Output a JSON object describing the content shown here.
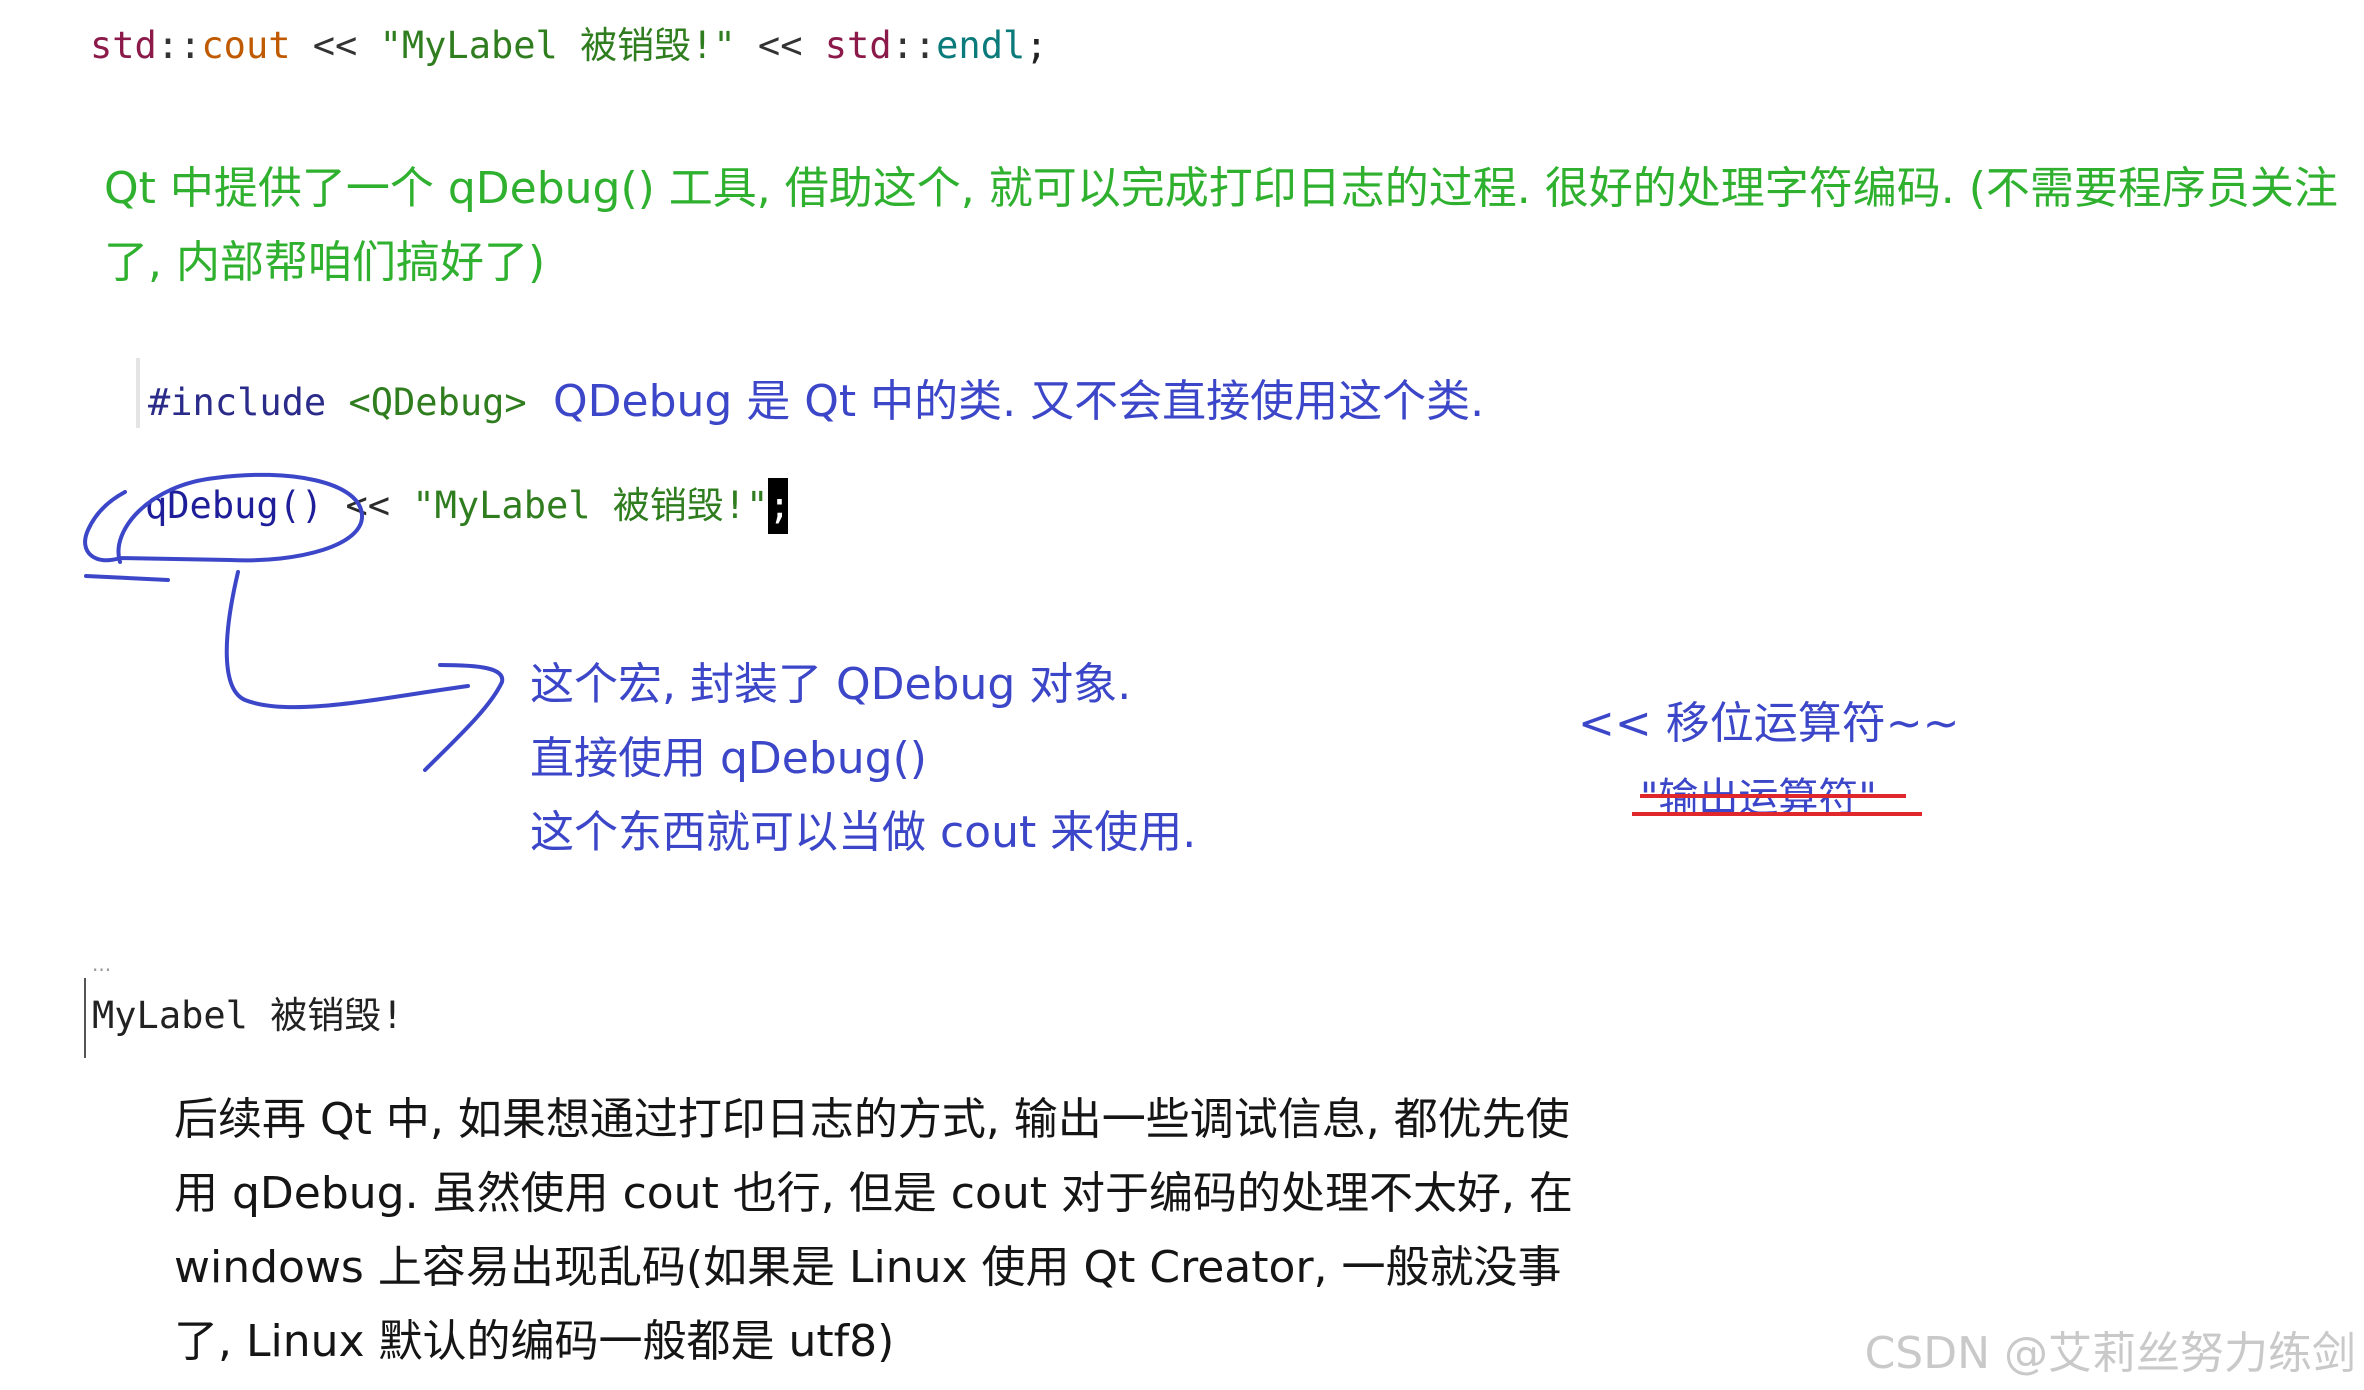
{
  "code_line_1": {
    "ns1": "std",
    "sep1": "::",
    "cout": "cout",
    "op1": " << ",
    "str": "\"MyLabel 被销毁!\"",
    "op2": " << ",
    "ns2": "std",
    "sep2": "::",
    "endl": "endl",
    "semi": ";"
  },
  "green_note": "Qt 中提供了一个 qDebug() 工具, 借助这个, 就可以完成打印日志的过程. 很好的处理字符编码. (不需要程序员关注了, 内部帮咱们搞好了)",
  "include_line": {
    "directive": "#include ",
    "header": "<QDebug>"
  },
  "include_note": "QDebug 是 Qt 中的类. 又不会直接使用这个类.",
  "qdebug_line": {
    "call": "qDebug()",
    "op": " << ",
    "str": "\"MyLabel 被销毁!\"",
    "semi": ";"
  },
  "macro_notes": [
    "这个宏, 封装了 QDebug 对象.",
    "直接使用 qDebug()",
    "这个东西就可以当做 cout 来使用."
  ],
  "shift_note": "<< 移位运算符~~",
  "output_note": "\"输出运算符\"",
  "console_output": "MyLabel 被销毁!",
  "console_dots": "...",
  "black_paragraph": "后续再 Qt 中, 如果想通过打印日志的方式, 输出一些调试信息, 都优先使用 qDebug. 虽然使用 cout 也行, 但是 cout 对于编码的处理不太好, 在 windows 上容易出现乱码(如果是 Linux 使用 Qt Creator, 一般就没事了, Linux 默认的编码一般都是 utf8)",
  "watermark": "CSDN @艾莉丝努力练剑",
  "colors": {
    "green_note": "#2fb12f",
    "blue_ink": "#3c46c8",
    "red_strike": "#e0282c"
  }
}
